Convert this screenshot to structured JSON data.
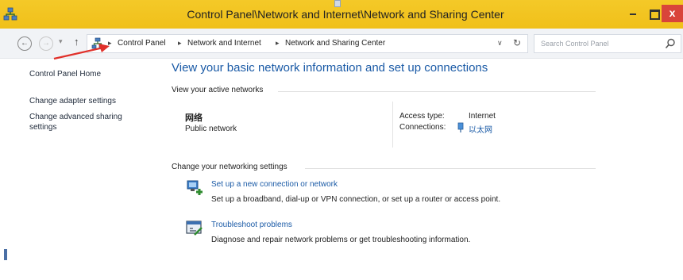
{
  "window": {
    "title": "Control Panel\\Network and Internet\\Network and Sharing Center",
    "close_label": "x"
  },
  "nav": {
    "breadcrumbs": [
      "Control Panel",
      "Network and Internet",
      "Network and Sharing Center"
    ],
    "search_placeholder": "Search Control Panel"
  },
  "left_pane": {
    "home": "Control Panel Home",
    "adapter": "Change adapter settings",
    "advanced_line1": "Change advanced sharing",
    "advanced_line2": "settings"
  },
  "main": {
    "title": "View your basic network information and set up connections",
    "active_networks_heading": "View your active networks",
    "network_name": "网络",
    "network_type": "Public network",
    "access_type_label": "Access type:",
    "access_type_value": "Internet",
    "connections_label": "Connections:",
    "connections_value": "以太网",
    "change_settings_heading": "Change your networking settings",
    "tasks": [
      {
        "icon": "new-connection-icon",
        "link": "Set up a new connection or network",
        "description": "Set up a broadband, dial-up or VPN connection, or set up a router or access point."
      },
      {
        "icon": "troubleshoot-icon",
        "link": "Troubleshoot problems",
        "description": "Diagnose and repair network problems or get troubleshooting information."
      }
    ]
  },
  "colors": {
    "titlebar": "#f0c01a",
    "link": "#1a5aa6",
    "close": "#d9443a",
    "annotation_arrow": "#e0302a"
  }
}
